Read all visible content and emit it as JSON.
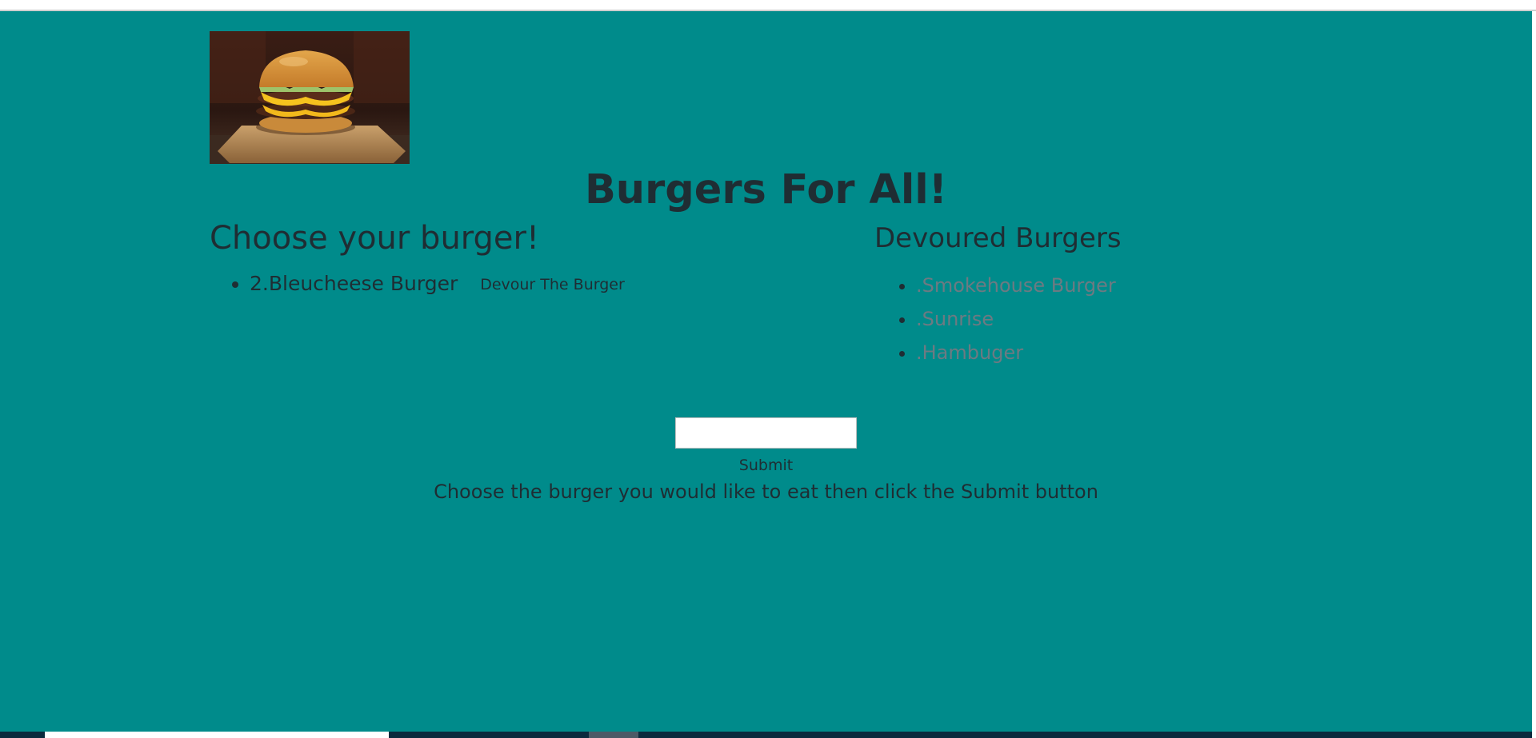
{
  "page": {
    "title": "Burgers For All!"
  },
  "logo": {
    "icon": "burger-photo"
  },
  "choose": {
    "heading": "Choose your burger!",
    "items": [
      {
        "label": "2.Bleucheese Burger",
        "button": "Devour The Burger"
      }
    ]
  },
  "devoured": {
    "heading": "Devoured Burgers",
    "items": [
      ".Smokehouse Burger",
      ".Sunrise",
      ".Hambuger"
    ]
  },
  "form": {
    "input_value": "",
    "submit_label": "Submit",
    "instructions": "Choose the burger you would like to eat then click the Submit button"
  },
  "colors": {
    "background": "#008b8b",
    "text": "#1f2d33",
    "devoured_item": "#6d7a82"
  }
}
